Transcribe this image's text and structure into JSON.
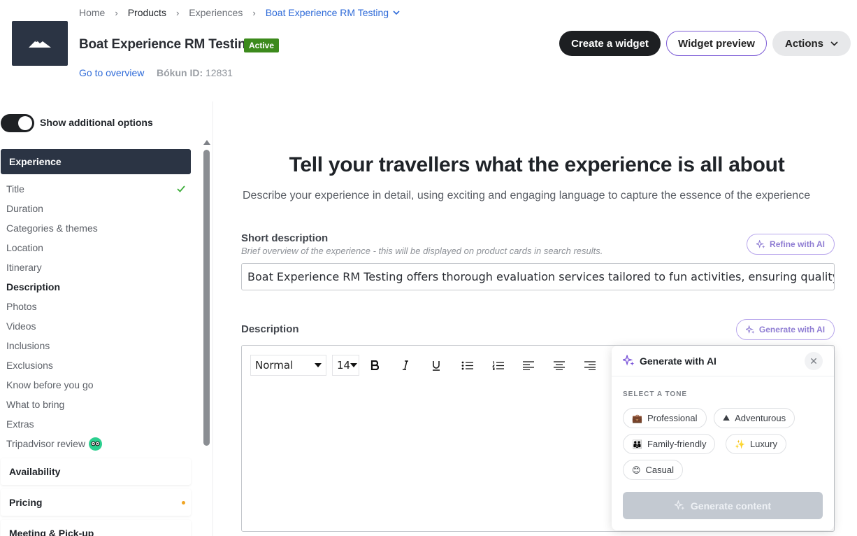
{
  "breadcrumb": {
    "home": "Home",
    "products": "Products",
    "experiences": "Experiences",
    "current": "Boat Experience RM Testing"
  },
  "product": {
    "title": "Boat Experience RM Testing",
    "status": "Active",
    "overview_link": "Go to overview",
    "id_label": "Bókun ID:",
    "id_value": "12831"
  },
  "header_actions": {
    "create_widget": "Create a widget",
    "widget_preview": "Widget preview",
    "actions": "Actions"
  },
  "sidebar": {
    "toggle_label": "Show additional options",
    "active_section": "Experience",
    "items": [
      {
        "label": "Title",
        "done": true
      },
      {
        "label": "Duration"
      },
      {
        "label": "Categories & themes"
      },
      {
        "label": "Location"
      },
      {
        "label": "Itinerary"
      },
      {
        "label": "Description",
        "current": true
      },
      {
        "label": "Photos"
      },
      {
        "label": "Videos"
      },
      {
        "label": "Inclusions"
      },
      {
        "label": "Exclusions"
      },
      {
        "label": "Know before you go"
      },
      {
        "label": "What to bring"
      },
      {
        "label": "Extras"
      },
      {
        "label": "Tripadvisor review"
      }
    ],
    "sections": [
      "Availability",
      "Pricing",
      "Meeting & Pick-up"
    ]
  },
  "main": {
    "title": "Tell your travellers what the experience is all about",
    "subtitle": "Describe your experience in detail, using exciting and engaging language to capture the essence of the experience",
    "short_description": {
      "label": "Short description",
      "help": "Brief overview of the experience - this will be displayed on product cards in search results.",
      "value": "Boat Experience RM Testing offers thorough evaluation services tailored to fun activities, ensuring quality",
      "refine_button": "Refine with AI"
    },
    "description": {
      "label": "Description",
      "generate_button": "Generate with AI",
      "style_select": "Normal",
      "size_select": "14"
    }
  },
  "ai_popover": {
    "title": "Generate with AI",
    "tone_label": "SELECT A TONE",
    "tones": [
      {
        "label": "Professional",
        "icon": "briefcase-icon"
      },
      {
        "label": "Adventurous",
        "icon": "mountain-icon"
      },
      {
        "label": "Family-friendly",
        "icon": "family-icon"
      },
      {
        "label": "Luxury",
        "icon": "sparkles-icon"
      },
      {
        "label": "Casual",
        "icon": "smile-icon"
      }
    ],
    "generate_button": "Generate content"
  },
  "colors": {
    "link_blue": "#2e6ad8",
    "active_green": "#3c8a1c",
    "ai_purple": "#8f7dd3",
    "nav_dark": "#2b3444"
  }
}
